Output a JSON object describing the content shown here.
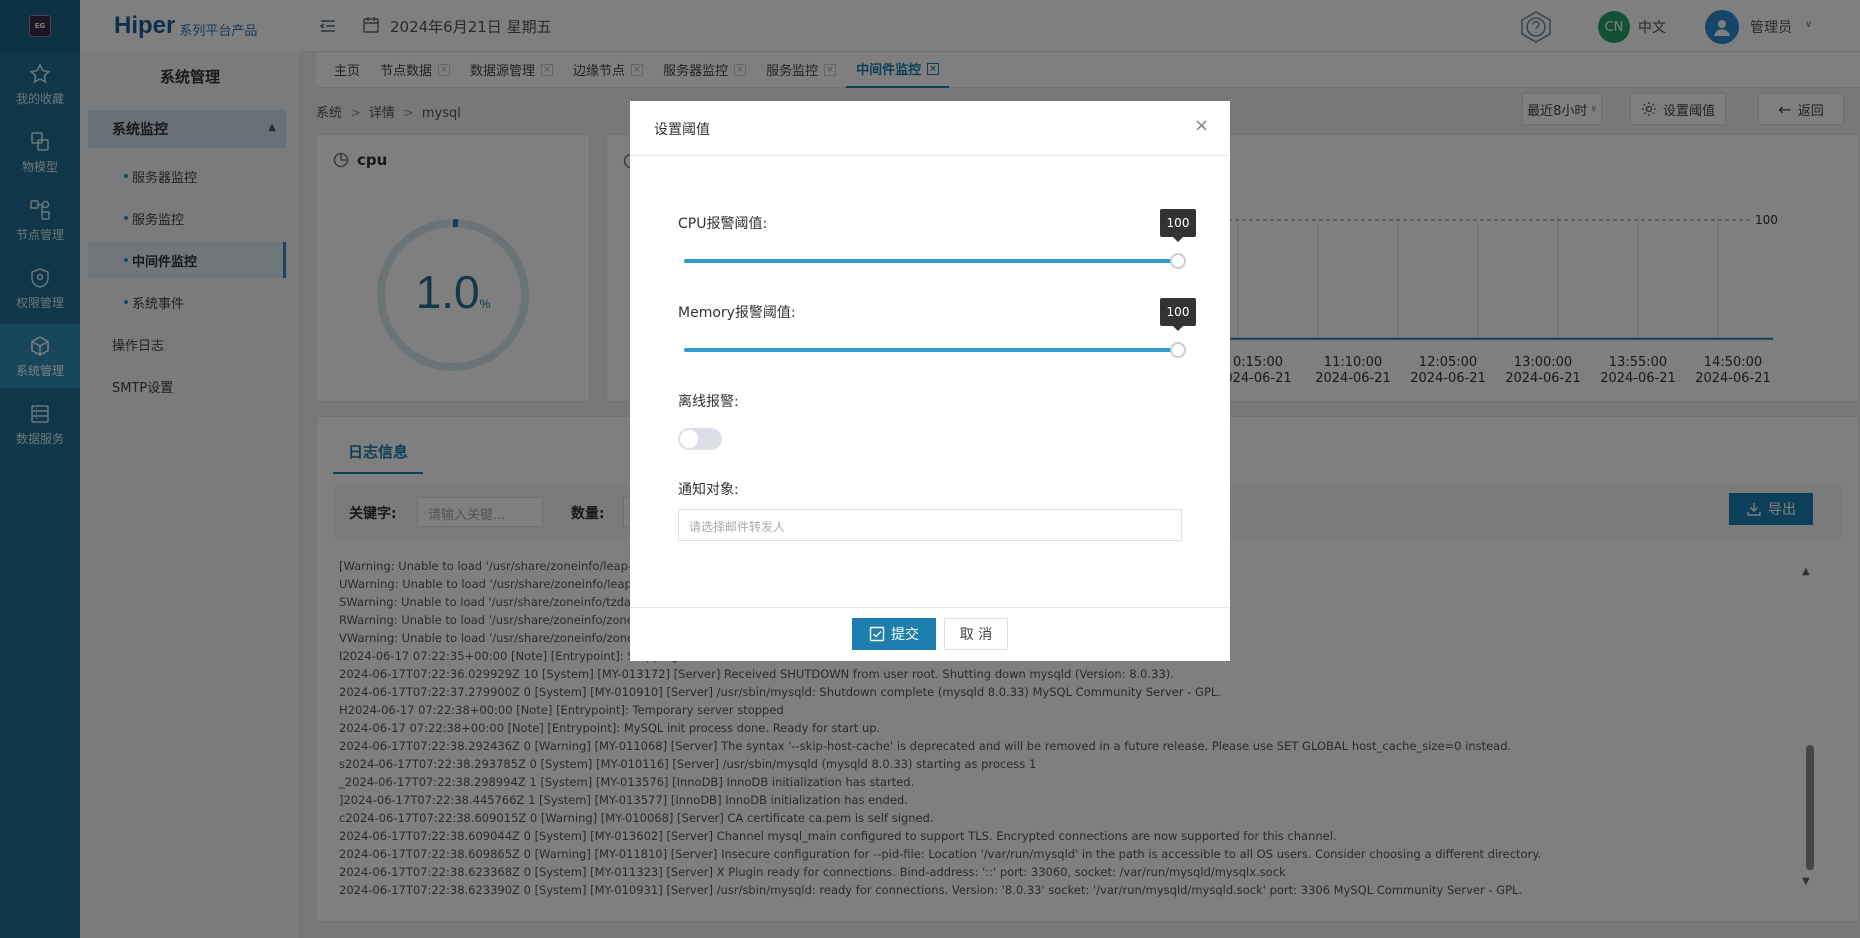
{
  "rail": {
    "logo_text": "EG",
    "items": [
      {
        "label": "我的收藏",
        "icon": "star-icon"
      },
      {
        "label": "物模型",
        "icon": "model-icon"
      },
      {
        "label": "节点管理",
        "icon": "node-icon"
      },
      {
        "label": "权限管理",
        "icon": "shield-icon"
      },
      {
        "label": "系统管理",
        "icon": "cube-icon"
      },
      {
        "label": "数据服务",
        "icon": "database-icon"
      }
    ],
    "active_index": 4
  },
  "brand": {
    "main": "Hiper",
    "sub": "系列平台产品"
  },
  "header": {
    "date": "2024年6月21日 星期五",
    "lang_badge": "CN",
    "lang_label": "中文",
    "user": "管理员"
  },
  "sidebar": {
    "title": "系统管理",
    "group": "系统监控",
    "subitems": [
      "服务器监控",
      "服务监控",
      "中间件监控",
      "系统事件"
    ],
    "active_sub": 2,
    "plain_items": [
      "操作日志",
      "SMTP设置"
    ]
  },
  "tabs": [
    {
      "label": "主页",
      "closable": false
    },
    {
      "label": "节点数据",
      "closable": true
    },
    {
      "label": "数据源管理",
      "closable": true
    },
    {
      "label": "边缘节点",
      "closable": true
    },
    {
      "label": "服务器监控",
      "closable": true
    },
    {
      "label": "服务监控",
      "closable": true
    },
    {
      "label": "中间件监控",
      "closable": true,
      "active": true
    }
  ],
  "breadcrumb": [
    "系统",
    "详情",
    "mysql"
  ],
  "toolbar": {
    "range": "最近8小时",
    "threshold": "设置阈值",
    "back": "返回"
  },
  "cpu_card": {
    "title": "cpu",
    "value": "1.0",
    "unit": "%"
  },
  "chart_data": {
    "type": "line",
    "x": [
      "10:15:00\n2024-06-21",
      "11:10:00\n2024-06-21",
      "12:05:00\n2024-06-21",
      "13:00:00\n2024-06-21",
      "13:55:00\n2024-06-21",
      "14:50:00\n2024-06-21"
    ],
    "x_labels_time": [
      "0:15:00",
      "11:10:00",
      "12:05:00",
      "13:00:00",
      "13:55:00",
      "14:50:00"
    ],
    "x_labels_date": [
      "024-06-21",
      "2024-06-21",
      "2024-06-21",
      "2024-06-21",
      "2024-06-21",
      "2024-06-21"
    ],
    "threshold_label": "100",
    "series": [
      {
        "values": [
          1,
          1,
          1,
          1,
          1,
          1
        ]
      }
    ],
    "ylim": [
      0,
      100
    ]
  },
  "log": {
    "tab": "日志信息",
    "keyword_label": "关键字:",
    "keyword_placeholder": "请输入关键...",
    "count_label": "数量:",
    "export": "导出",
    "lines": [
      "[Warning: Unable to load '/usr/share/zoneinfo/leap-sec",
      "UWarning: Unable to load '/usr/share/zoneinfo/leapsec",
      "SWarning: Unable to load '/usr/share/zoneinfo/tzdata.z",
      "RWarning: Unable to load '/usr/share/zoneinfo/zone.ta",
      "VWarning: Unable to load '/usr/share/zoneinfo/zone19",
      "I2024-06-17 07:22:35+00:00 [Note] [Entrypoint]: Stopping",
      "2024-06-17T07:22:36.029929Z 10 [System] [MY-013172] [Server] Received SHUTDOWN from user root. Shutting down mysqld (Version: 8.0.33).",
      "2024-06-17T07:22:37.279900Z 0 [System] [MY-010910] [Server] /usr/sbin/mysqld: Shutdown complete (mysqld 8.0.33) MySQL Community Server - GPL.",
      "H2024-06-17 07:22:38+00:00 [Note] [Entrypoint]: Temporary server stopped",
      "2024-06-17 07:22:38+00:00 [Note] [Entrypoint]: MySQL init process done. Ready for start up.",
      "2024-06-17T07:22:38.292436Z 0 [Warning] [MY-011068] [Server] The syntax '--skip-host-cache' is deprecated and will be removed in a future release. Please use SET GLOBAL host_cache_size=0 instead.",
      "s2024-06-17T07:22:38.293785Z 0 [System] [MY-010116] [Server] /usr/sbin/mysqld (mysqld 8.0.33) starting as process 1",
      "_2024-06-17T07:22:38.298994Z 1 [System] [MY-013576] [InnoDB] InnoDB initialization has started.",
      "]2024-06-17T07:22:38.445766Z 1 [System] [MY-013577] [InnoDB] InnoDB initialization has ended.",
      "c2024-06-17T07:22:38.609015Z 0 [Warning] [MY-010068] [Server] CA certificate ca.pem is self signed.",
      "2024-06-17T07:22:38.609044Z 0 [System] [MY-013602] [Server] Channel mysql_main configured to support TLS. Encrypted connections are now supported for this channel.",
      "2024-06-17T07:22:38.609865Z 0 [Warning] [MY-011810] [Server] Insecure configuration for --pid-file: Location '/var/run/mysqld' in the path is accessible to all OS users. Consider choosing a different directory.",
      "2024-06-17T07:22:38.623368Z 0 [System] [MY-011323] [Server] X Plugin ready for connections. Bind-address: '::' port: 33060, socket: /var/run/mysqld/mysqlx.sock",
      "2024-06-17T07:22:38.623390Z 0 [System] [MY-010931] [Server] /usr/sbin/mysqld: ready for connections. Version: '8.0.33' socket: '/var/run/mysqld/mysqld.sock' port: 3306 MySQL Community Server - GPL."
    ]
  },
  "modal": {
    "title": "设置阈值",
    "cpu_label": "CPU报警阈值:",
    "cpu_value": "100",
    "cpu_fraction": 1.0,
    "mem_label": "Memory报警阈值:",
    "mem_value": "100",
    "mem_fraction": 1.0,
    "offline_label": "离线报警:",
    "offline_on": false,
    "notify_label": "通知对象:",
    "notify_placeholder": "请选择邮件转发人",
    "submit": "提交",
    "cancel": "取 消"
  }
}
